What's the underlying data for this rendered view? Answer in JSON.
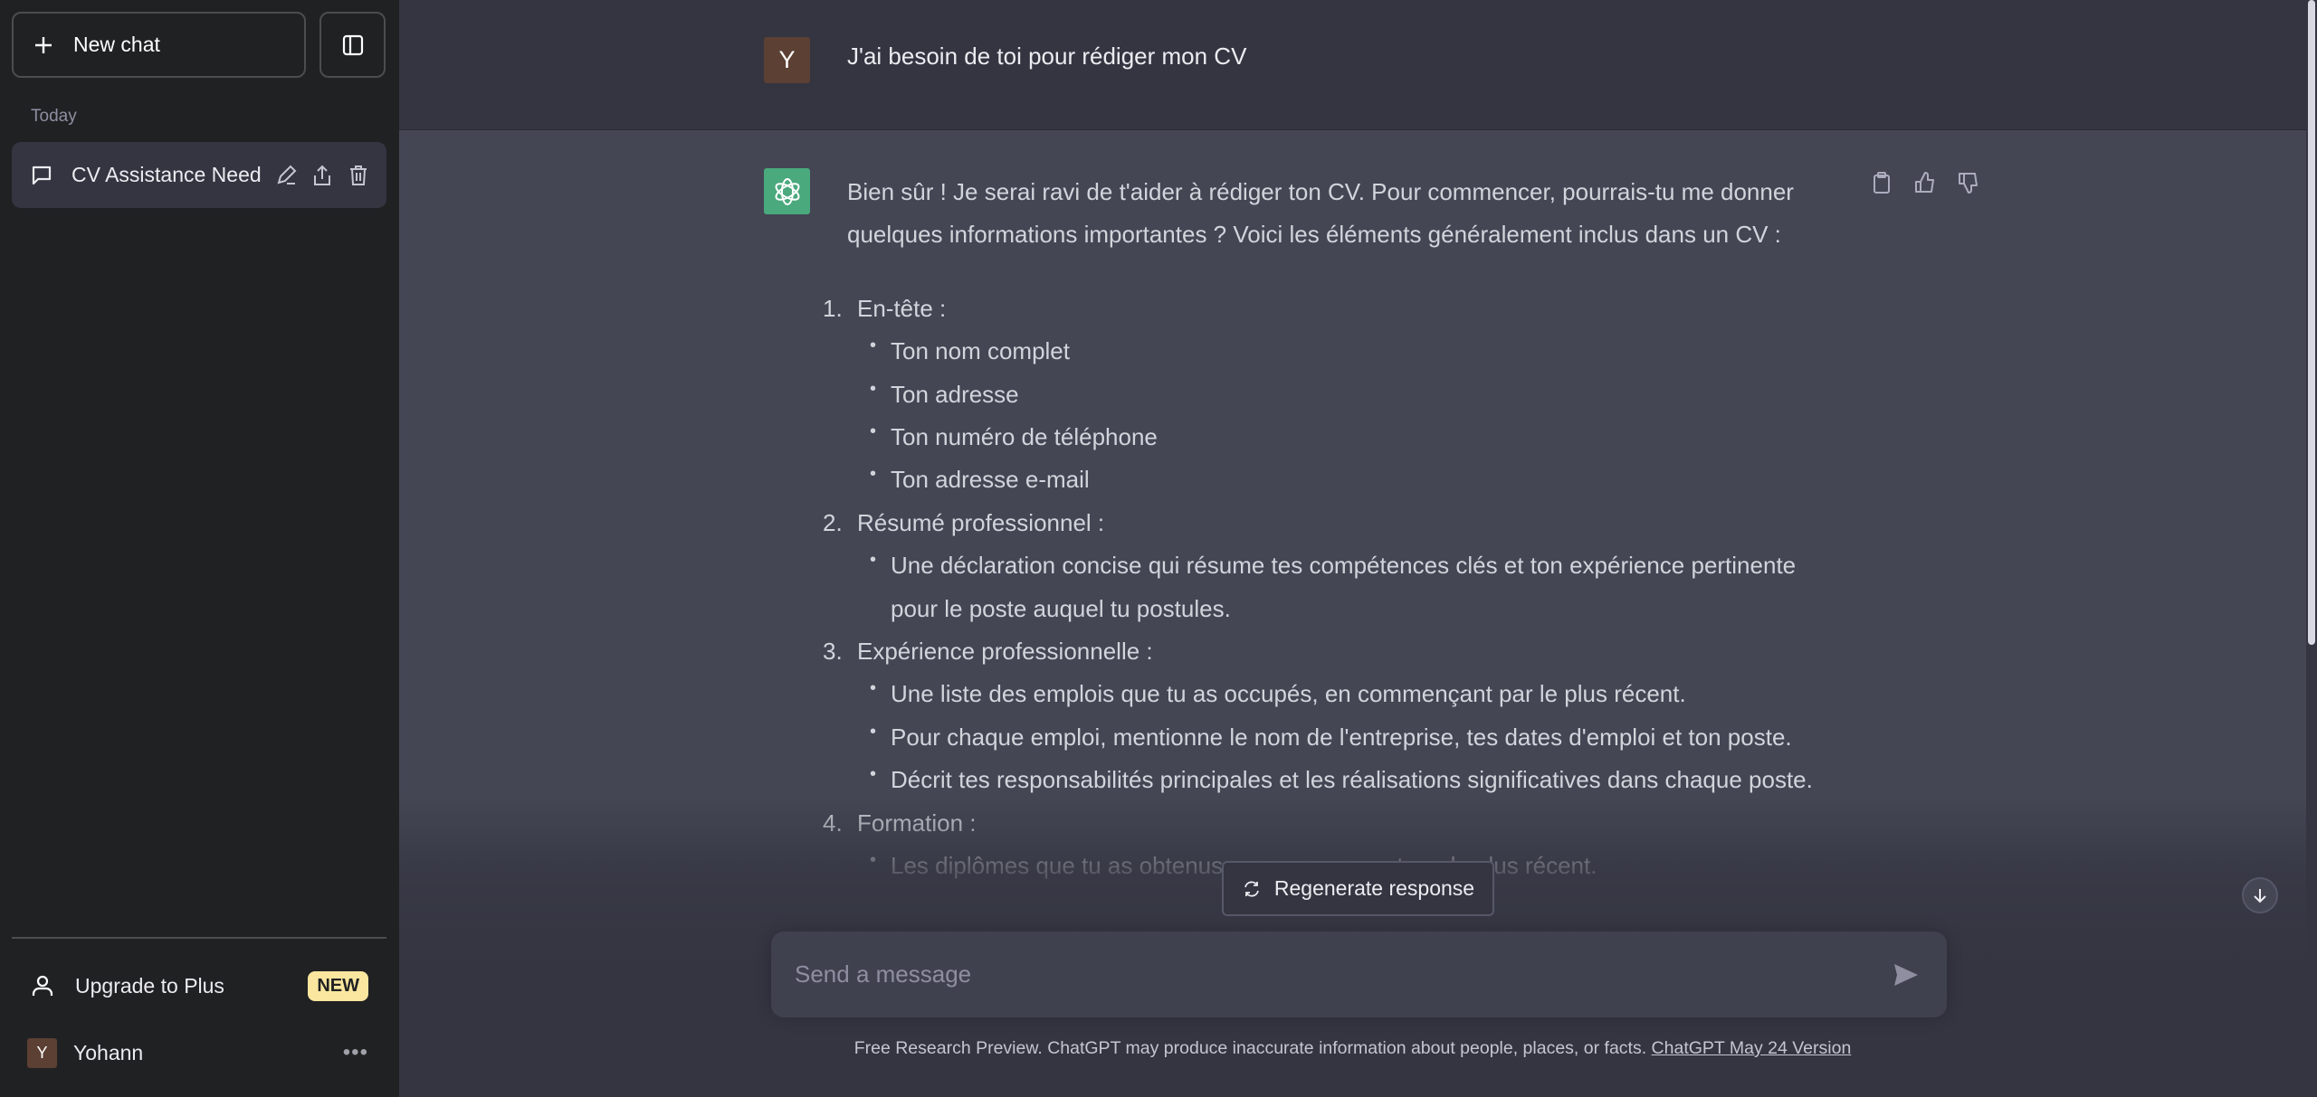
{
  "sidebar": {
    "new_chat": "New chat",
    "section_label": "Today",
    "chats": [
      {
        "title": "CV Assistance Need"
      }
    ],
    "upgrade": "Upgrade to Plus",
    "upgrade_badge": "NEW",
    "user": {
      "initial": "Y",
      "name": "Yohann"
    },
    "more": "•••"
  },
  "conversation": {
    "user_message": {
      "initial": "Y",
      "text": "J'ai besoin de toi pour rédiger mon CV"
    },
    "assistant_message": {
      "intro": "Bien sûr ! Je serai ravi de t'aider à rédiger ton CV. Pour commencer, pourrais-tu me donner quelques informations importantes ? Voici les éléments généralement inclus dans un CV :",
      "sections": [
        {
          "num": "1.",
          "title": "En-tête :",
          "items": [
            "Ton nom complet",
            "Ton adresse",
            "Ton numéro de téléphone",
            "Ton adresse e-mail"
          ]
        },
        {
          "num": "2.",
          "title": "Résumé professionnel :",
          "items": [
            "Une déclaration concise qui résume tes compétences clés et ton expérience pertinente pour le poste auquel tu postules."
          ]
        },
        {
          "num": "3.",
          "title": "Expérience professionnelle :",
          "items": [
            "Une liste des emplois que tu as occupés, en commençant par le plus récent.",
            "Pour chaque emploi, mentionne le nom de l'entreprise, tes dates d'emploi et ton poste.",
            "Décrit tes responsabilités principales et les réalisations significatives dans chaque poste."
          ]
        },
        {
          "num": "4.",
          "title": "Formation :",
          "items": [
            "Les diplômes que tu as obtenus, en commençant par le plus récent."
          ]
        }
      ]
    }
  },
  "regenerate": "Regenerate response",
  "composer": {
    "placeholder": "Send a message",
    "value": ""
  },
  "footer": {
    "text": "Free Research Preview. ChatGPT may produce inaccurate information about people, places, or facts. ",
    "link": "ChatGPT May 24 Version"
  },
  "colors": {
    "sidebar": "#202123",
    "main": "#343541",
    "assistant_bg": "#444654",
    "gpt_logo": "#4aa97d",
    "avatar": "#5c4033",
    "badge": "#fae69e"
  }
}
